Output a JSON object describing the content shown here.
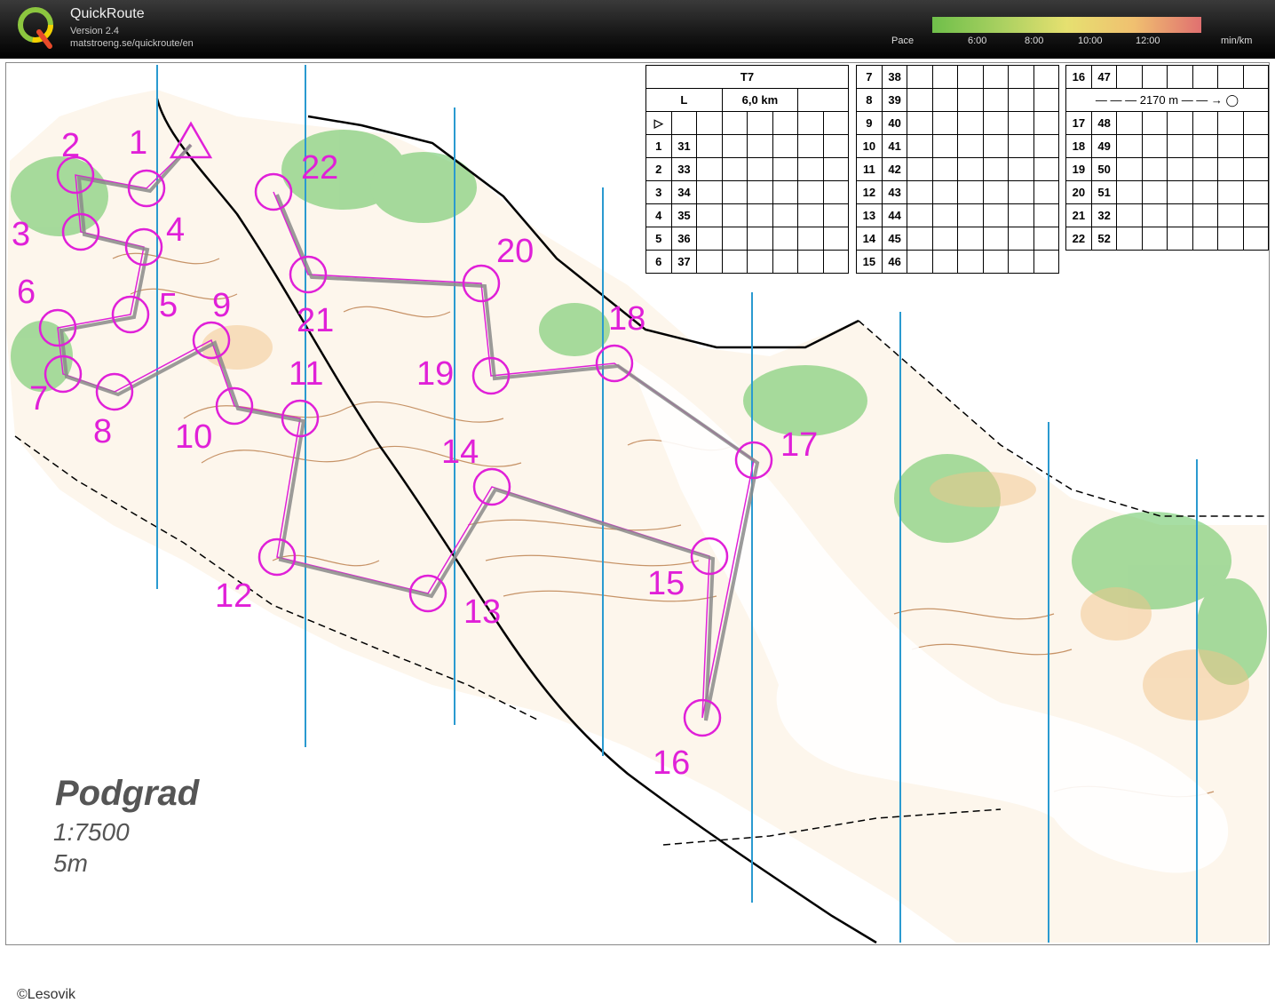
{
  "app": {
    "title": "QuickRoute",
    "version": "Version 2.4",
    "url": "matstroeng.se/quickroute/en",
    "logo_letter": "Q"
  },
  "pace": {
    "label": "Pace",
    "ticks": [
      "6:00",
      "8:00",
      "10:00",
      "12:00"
    ],
    "unit": "min/km",
    "gradient_colors": [
      "#6fbf4a",
      "#a8d060",
      "#e6e070",
      "#f0c070",
      "#e07070"
    ]
  },
  "map": {
    "name": "Podgrad",
    "scale": "1:7500",
    "equidistance": "5m",
    "copyright": "©Lesovik",
    "colors": {
      "course": "#e020d8",
      "route": "#8a8a8a",
      "contour": "#b06a30",
      "vegetation": "#5ec25a",
      "open_land": "#f2c48a",
      "magnetic_north": "#2a9ad0"
    },
    "control_numbers": [
      "1",
      "2",
      "3",
      "4",
      "5",
      "6",
      "7",
      "8",
      "9",
      "10",
      "11",
      "12",
      "13",
      "14",
      "15",
      "16",
      "17",
      "18",
      "19",
      "20",
      "21",
      "22"
    ]
  },
  "descriptions": {
    "header": {
      "course": "T7",
      "class": "L",
      "length": "6,0 km"
    },
    "col1": [
      {
        "n": "1",
        "code": "31"
      },
      {
        "n": "2",
        "code": "33"
      },
      {
        "n": "3",
        "code": "34"
      },
      {
        "n": "4",
        "code": "35"
      },
      {
        "n": "5",
        "code": "36"
      },
      {
        "n": "6",
        "code": "37"
      }
    ],
    "col2": [
      {
        "n": "7",
        "code": "38"
      },
      {
        "n": "8",
        "code": "39"
      },
      {
        "n": "9",
        "code": "40"
      },
      {
        "n": "10",
        "code": "41"
      },
      {
        "n": "11",
        "code": "42"
      },
      {
        "n": "12",
        "code": "43"
      },
      {
        "n": "13",
        "code": "44"
      },
      {
        "n": "14",
        "code": "45"
      },
      {
        "n": "15",
        "code": "46"
      }
    ],
    "col3": [
      {
        "n": "16",
        "code": "47"
      },
      {
        "n": "17",
        "code": "48"
      },
      {
        "n": "18",
        "code": "49"
      },
      {
        "n": "19",
        "code": "50"
      },
      {
        "n": "20",
        "code": "51"
      },
      {
        "n": "21",
        "code": "32"
      },
      {
        "n": "22",
        "code": "52"
      }
    ],
    "taped_route": "2170 m"
  }
}
